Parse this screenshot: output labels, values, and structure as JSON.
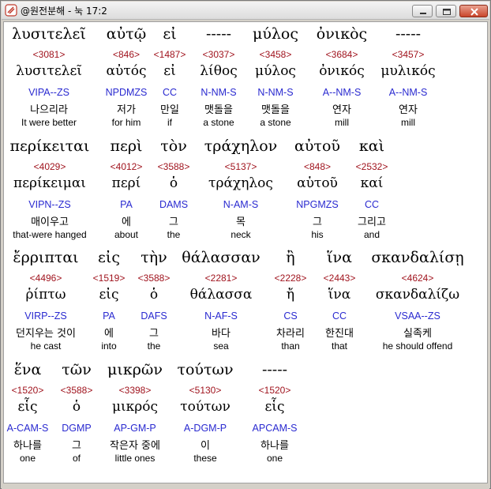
{
  "window": {
    "title": "@원전분해 - 눅 17:2",
    "controls": {
      "minimize_icon": "minimize-icon",
      "maximize_icon": "maximize-icon",
      "close_icon": "close-icon"
    }
  },
  "rows": [
    {
      "words": [
        {
          "greek": "λυσιτελεῖ",
          "strongs": "<3081>",
          "lemma": "λυσιτελεῖ",
          "parsing": "VIPA--ZS",
          "korean": "나으리라",
          "english": "It were better"
        },
        {
          "greek": "αὐτῷ",
          "strongs": "<846>",
          "lemma": "αὐτός",
          "parsing": "NPDMZS",
          "korean": "저가",
          "english": "for him"
        },
        {
          "greek": "εἰ",
          "strongs": "<1487>",
          "lemma": "εἰ",
          "parsing": "CC",
          "korean": "만일",
          "english": "if"
        },
        {
          "greek": "-----",
          "strongs": "<3037>",
          "lemma": "λίθος",
          "parsing": "N-NM-S",
          "korean": "맷돌을",
          "english": "a stone"
        },
        {
          "greek": "μύλος",
          "strongs": "<3458>",
          "lemma": "μύλος",
          "parsing": "N-NM-S",
          "korean": "맷돌을",
          "english": "a stone"
        },
        {
          "greek": "ὀνικὸς",
          "strongs": "<3684>",
          "lemma": "ὀνικός",
          "parsing": "A--NM-S",
          "korean": "연자",
          "english": "mill"
        },
        {
          "greek": "-----",
          "strongs": "<3457>",
          "lemma": "μυλικός",
          "parsing": "A--NM-S",
          "korean": "연자",
          "english": "mill"
        }
      ]
    },
    {
      "words": [
        {
          "greek": "περίκειται",
          "strongs": "<4029>",
          "lemma": "περίκειμαι",
          "parsing": "VIPN--ZS",
          "korean": "매이우고",
          "english": "that-were hanged"
        },
        {
          "greek": "περὶ",
          "strongs": "<4012>",
          "lemma": "περί",
          "parsing": "PA",
          "korean": "에",
          "english": "about"
        },
        {
          "greek": "τὸν",
          "strongs": "<3588>",
          "lemma": "ὁ",
          "parsing": "DAMS",
          "korean": "그",
          "english": "the"
        },
        {
          "greek": "τράχηλον",
          "strongs": "<5137>",
          "lemma": "τράχηλος",
          "parsing": "N-AM-S",
          "korean": "목",
          "english": "neck"
        },
        {
          "greek": "αὐτοῦ",
          "strongs": "<848>",
          "lemma": "αὑτοῦ",
          "parsing": "NPGMZS",
          "korean": "그",
          "english": "his"
        },
        {
          "greek": "καὶ",
          "strongs": "<2532>",
          "lemma": "καί",
          "parsing": "CC",
          "korean": "그리고",
          "english": "and"
        }
      ]
    },
    {
      "words": [
        {
          "greek": "ἔρριπται",
          "strongs": "<4496>",
          "lemma": "ῥίπτω",
          "parsing": "VIRP--ZS",
          "korean": "던지우는 것이",
          "english": "he cast"
        },
        {
          "greek": "εἰς",
          "strongs": "<1519>",
          "lemma": "εἰς",
          "parsing": "PA",
          "korean": "에",
          "english": "into"
        },
        {
          "greek": "τὴν",
          "strongs": "<3588>",
          "lemma": "ὁ",
          "parsing": "DAFS",
          "korean": "그",
          "english": "the"
        },
        {
          "greek": "θάλασσαν",
          "strongs": "<2281>",
          "lemma": "θάλασσα",
          "parsing": "N-AF-S",
          "korean": "바다",
          "english": "sea"
        },
        {
          "greek": "ἢ",
          "strongs": "<2228>",
          "lemma": "ἤ",
          "parsing": "CS",
          "korean": "차라리",
          "english": "than"
        },
        {
          "greek": "ἵνα",
          "strongs": "<2443>",
          "lemma": "ἵνα",
          "parsing": "CC",
          "korean": "한진대",
          "english": "that"
        },
        {
          "greek": "σκανδαλίσῃ",
          "strongs": "<4624>",
          "lemma": "σκανδαλίζω",
          "parsing": "VSAA--ZS",
          "korean": "실족케",
          "english": "he should offend"
        }
      ]
    },
    {
      "words": [
        {
          "greek": "ἕνα",
          "strongs": "<1520>",
          "lemma": "εἷς",
          "parsing": "A-CAM-S",
          "korean": "하나를",
          "english": "one"
        },
        {
          "greek": "τῶν",
          "strongs": "<3588>",
          "lemma": "ὁ",
          "parsing": "DGMP",
          "korean": "그",
          "english": "of"
        },
        {
          "greek": "μικρῶν",
          "strongs": "<3398>",
          "lemma": "μικρός",
          "parsing": "AP-GM-P",
          "korean": "작은자 중에",
          "english": "little ones"
        },
        {
          "greek": "τούτων",
          "strongs": "<5130>",
          "lemma": "τούτων",
          "parsing": "A-DGM-P",
          "korean": "이",
          "english": "these"
        },
        {
          "greek": "-----",
          "strongs": "<1520>",
          "lemma": "εἷς",
          "parsing": "APCAM-S",
          "korean": "하나를",
          "english": "one"
        }
      ]
    }
  ],
  "colors": {
    "strongs": "#a0141e",
    "parsing": "#2a2ad0",
    "text": "#000000",
    "close_button": "#c9452b"
  }
}
